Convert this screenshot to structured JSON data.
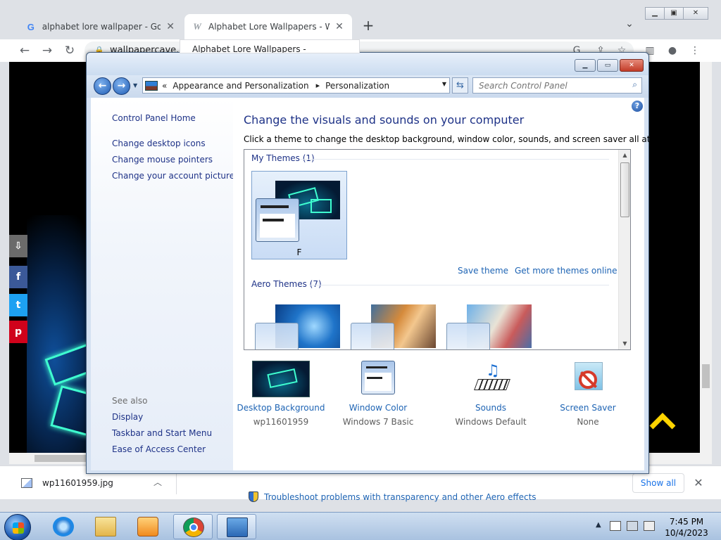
{
  "browser": {
    "tabs": [
      {
        "title": "alphabet lore wallpaper - Google Search",
        "favicon": "google-icon"
      },
      {
        "title": "Alphabet Lore Wallpapers - Wallpaper Cave",
        "favicon": "wallpapercave-icon"
      }
    ],
    "tab_preview": "Alphabet Lore Wallpapers -",
    "address": "wallpapercave.com",
    "new_tab": "+",
    "downloads": {
      "filename": "wp11601959.jpg",
      "show_all": "Show all"
    }
  },
  "control_panel": {
    "breadcrumb": [
      "Appearance and Personalization",
      "Personalization"
    ],
    "breadcrumb_prefix": "«",
    "search_placeholder": "Search Control Panel",
    "left_pane": {
      "home": "Control Panel Home",
      "links": [
        "Change desktop icons",
        "Change mouse pointers",
        "Change your account picture"
      ],
      "see_also_label": "See also",
      "see_also": [
        "Display",
        "Taskbar and Start Menu",
        "Ease of Access Center"
      ]
    },
    "main": {
      "heading": "Change the visuals and sounds on your computer",
      "description": "Click a theme to change the desktop background, window color, sounds, and screen saver all at once.",
      "my_themes_header": "My Themes (1)",
      "my_theme_name": "F",
      "save_theme": "Save theme",
      "get_more_themes": "Get more themes online",
      "aero_themes_header": "Aero Themes (7)"
    },
    "settings": [
      {
        "label": "Desktop Background",
        "value": "wp11601959"
      },
      {
        "label": "Window Color",
        "value": "Windows 7 Basic"
      },
      {
        "label": "Sounds",
        "value": "Windows Default"
      },
      {
        "label": "Screen Saver",
        "value": "None"
      }
    ],
    "troubleshoot": "Troubleshoot problems with transparency and other Aero effects",
    "help": "?"
  },
  "taskbar": {
    "time": "7:45 PM",
    "date": "10/4/2023"
  },
  "colors": {
    "link_blue": "#1e64b4",
    "heading_blue": "#1e3287",
    "neon": "#3fffd0",
    "arrow_yellow": "#ffd400"
  }
}
